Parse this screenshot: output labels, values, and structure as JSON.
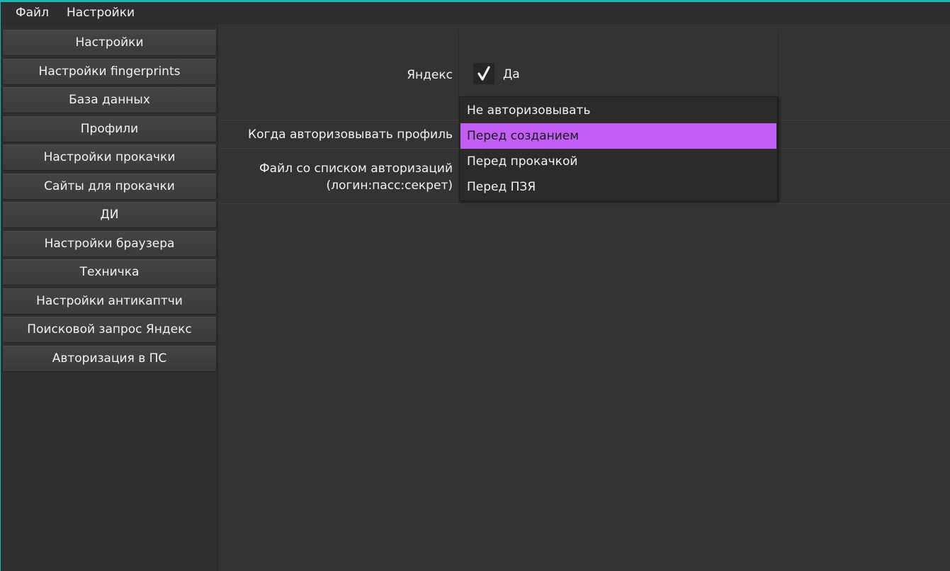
{
  "menubar": {
    "items": [
      "Файл",
      "Настройки"
    ]
  },
  "sidebar": {
    "items": [
      "Настройки",
      "Настройки fingerprints",
      "База данных",
      "Профили",
      "Настройки прокачки",
      "Сайты для прокачки",
      "ДИ",
      "Настройки браузера",
      "Техничка",
      "Настройки антикаптчи",
      "Поисковой запрос Яндекс",
      "Авторизация в ПС"
    ]
  },
  "form": {
    "yandex_label": "Яндекс",
    "yandex_checkbox_label": "Да",
    "yandex_checked": true,
    "when_auth_label": "Когда авторизовывать профиль",
    "file_label_line1": "Файл со списком авторизаций",
    "file_label_line2": "(логин:пасс:секрет)"
  },
  "dropdown": {
    "options": [
      "Не авторизовывать",
      "Перед созданием",
      "Перед прокачкой",
      "Перед ПЗЯ"
    ],
    "highlighted": "Перед созданием"
  },
  "colors": {
    "accent": "#1fb4b4",
    "highlight": "#c25ef5",
    "background": "#323232"
  }
}
